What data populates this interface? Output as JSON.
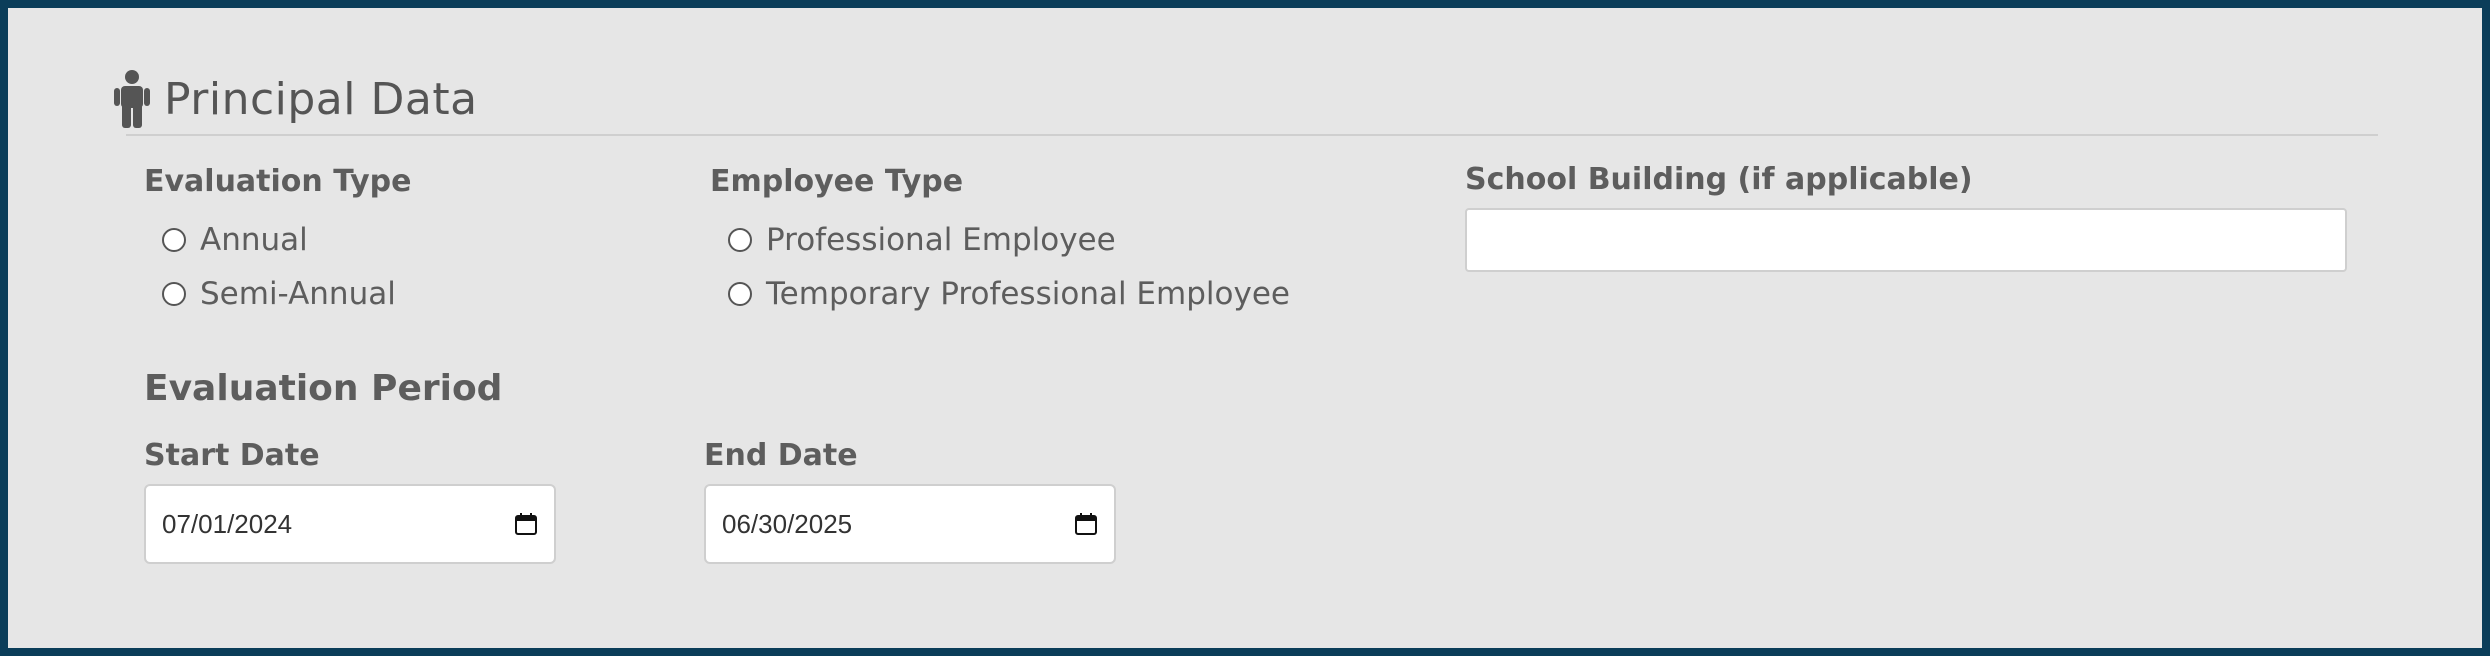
{
  "section": {
    "title": "Principal Data",
    "icon": "person-icon"
  },
  "evaluation_type": {
    "label": "Evaluation Type",
    "options": [
      "Annual",
      "Semi-Annual"
    ]
  },
  "employee_type": {
    "label": "Employee Type",
    "options": [
      "Professional Employee",
      "Temporary Professional Employee"
    ]
  },
  "school_building": {
    "label": "School Building (if applicable)",
    "value": ""
  },
  "evaluation_period": {
    "title": "Evaluation Period",
    "start": {
      "label": "Start Date",
      "value": "07/01/2024"
    },
    "end": {
      "label": "End Date",
      "value": "06/30/2025"
    }
  },
  "colors": {
    "frame": "#0b3d59",
    "panel": "#e6e6e6",
    "text": "#5d5d5d"
  }
}
